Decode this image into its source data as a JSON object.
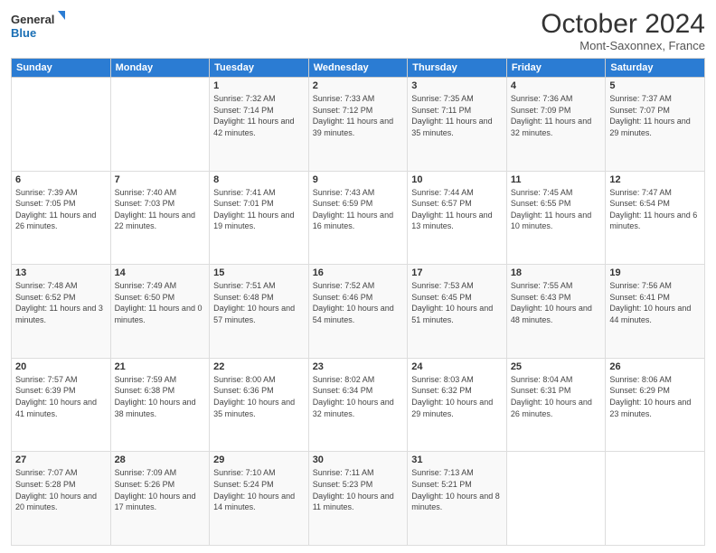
{
  "header": {
    "logo_line1": "General",
    "logo_line2": "Blue",
    "month_title": "October 2024",
    "location": "Mont-Saxonnex, France"
  },
  "weekdays": [
    "Sunday",
    "Monday",
    "Tuesday",
    "Wednesday",
    "Thursday",
    "Friday",
    "Saturday"
  ],
  "weeks": [
    [
      {
        "day": "",
        "sunrise": "",
        "sunset": "",
        "daylight": ""
      },
      {
        "day": "",
        "sunrise": "",
        "sunset": "",
        "daylight": ""
      },
      {
        "day": "1",
        "sunrise": "Sunrise: 7:32 AM",
        "sunset": "Sunset: 7:14 PM",
        "daylight": "Daylight: 11 hours and 42 minutes."
      },
      {
        "day": "2",
        "sunrise": "Sunrise: 7:33 AM",
        "sunset": "Sunset: 7:12 PM",
        "daylight": "Daylight: 11 hours and 39 minutes."
      },
      {
        "day": "3",
        "sunrise": "Sunrise: 7:35 AM",
        "sunset": "Sunset: 7:11 PM",
        "daylight": "Daylight: 11 hours and 35 minutes."
      },
      {
        "day": "4",
        "sunrise": "Sunrise: 7:36 AM",
        "sunset": "Sunset: 7:09 PM",
        "daylight": "Daylight: 11 hours and 32 minutes."
      },
      {
        "day": "5",
        "sunrise": "Sunrise: 7:37 AM",
        "sunset": "Sunset: 7:07 PM",
        "daylight": "Daylight: 11 hours and 29 minutes."
      }
    ],
    [
      {
        "day": "6",
        "sunrise": "Sunrise: 7:39 AM",
        "sunset": "Sunset: 7:05 PM",
        "daylight": "Daylight: 11 hours and 26 minutes."
      },
      {
        "day": "7",
        "sunrise": "Sunrise: 7:40 AM",
        "sunset": "Sunset: 7:03 PM",
        "daylight": "Daylight: 11 hours and 22 minutes."
      },
      {
        "day": "8",
        "sunrise": "Sunrise: 7:41 AM",
        "sunset": "Sunset: 7:01 PM",
        "daylight": "Daylight: 11 hours and 19 minutes."
      },
      {
        "day": "9",
        "sunrise": "Sunrise: 7:43 AM",
        "sunset": "Sunset: 6:59 PM",
        "daylight": "Daylight: 11 hours and 16 minutes."
      },
      {
        "day": "10",
        "sunrise": "Sunrise: 7:44 AM",
        "sunset": "Sunset: 6:57 PM",
        "daylight": "Daylight: 11 hours and 13 minutes."
      },
      {
        "day": "11",
        "sunrise": "Sunrise: 7:45 AM",
        "sunset": "Sunset: 6:55 PM",
        "daylight": "Daylight: 11 hours and 10 minutes."
      },
      {
        "day": "12",
        "sunrise": "Sunrise: 7:47 AM",
        "sunset": "Sunset: 6:54 PM",
        "daylight": "Daylight: 11 hours and 6 minutes."
      }
    ],
    [
      {
        "day": "13",
        "sunrise": "Sunrise: 7:48 AM",
        "sunset": "Sunset: 6:52 PM",
        "daylight": "Daylight: 11 hours and 3 minutes."
      },
      {
        "day": "14",
        "sunrise": "Sunrise: 7:49 AM",
        "sunset": "Sunset: 6:50 PM",
        "daylight": "Daylight: 11 hours and 0 minutes."
      },
      {
        "day": "15",
        "sunrise": "Sunrise: 7:51 AM",
        "sunset": "Sunset: 6:48 PM",
        "daylight": "Daylight: 10 hours and 57 minutes."
      },
      {
        "day": "16",
        "sunrise": "Sunrise: 7:52 AM",
        "sunset": "Sunset: 6:46 PM",
        "daylight": "Daylight: 10 hours and 54 minutes."
      },
      {
        "day": "17",
        "sunrise": "Sunrise: 7:53 AM",
        "sunset": "Sunset: 6:45 PM",
        "daylight": "Daylight: 10 hours and 51 minutes."
      },
      {
        "day": "18",
        "sunrise": "Sunrise: 7:55 AM",
        "sunset": "Sunset: 6:43 PM",
        "daylight": "Daylight: 10 hours and 48 minutes."
      },
      {
        "day": "19",
        "sunrise": "Sunrise: 7:56 AM",
        "sunset": "Sunset: 6:41 PM",
        "daylight": "Daylight: 10 hours and 44 minutes."
      }
    ],
    [
      {
        "day": "20",
        "sunrise": "Sunrise: 7:57 AM",
        "sunset": "Sunset: 6:39 PM",
        "daylight": "Daylight: 10 hours and 41 minutes."
      },
      {
        "day": "21",
        "sunrise": "Sunrise: 7:59 AM",
        "sunset": "Sunset: 6:38 PM",
        "daylight": "Daylight: 10 hours and 38 minutes."
      },
      {
        "day": "22",
        "sunrise": "Sunrise: 8:00 AM",
        "sunset": "Sunset: 6:36 PM",
        "daylight": "Daylight: 10 hours and 35 minutes."
      },
      {
        "day": "23",
        "sunrise": "Sunrise: 8:02 AM",
        "sunset": "Sunset: 6:34 PM",
        "daylight": "Daylight: 10 hours and 32 minutes."
      },
      {
        "day": "24",
        "sunrise": "Sunrise: 8:03 AM",
        "sunset": "Sunset: 6:32 PM",
        "daylight": "Daylight: 10 hours and 29 minutes."
      },
      {
        "day": "25",
        "sunrise": "Sunrise: 8:04 AM",
        "sunset": "Sunset: 6:31 PM",
        "daylight": "Daylight: 10 hours and 26 minutes."
      },
      {
        "day": "26",
        "sunrise": "Sunrise: 8:06 AM",
        "sunset": "Sunset: 6:29 PM",
        "daylight": "Daylight: 10 hours and 23 minutes."
      }
    ],
    [
      {
        "day": "27",
        "sunrise": "Sunrise: 7:07 AM",
        "sunset": "Sunset: 5:28 PM",
        "daylight": "Daylight: 10 hours and 20 minutes."
      },
      {
        "day": "28",
        "sunrise": "Sunrise: 7:09 AM",
        "sunset": "Sunset: 5:26 PM",
        "daylight": "Daylight: 10 hours and 17 minutes."
      },
      {
        "day": "29",
        "sunrise": "Sunrise: 7:10 AM",
        "sunset": "Sunset: 5:24 PM",
        "daylight": "Daylight: 10 hours and 14 minutes."
      },
      {
        "day": "30",
        "sunrise": "Sunrise: 7:11 AM",
        "sunset": "Sunset: 5:23 PM",
        "daylight": "Daylight: 10 hours and 11 minutes."
      },
      {
        "day": "31",
        "sunrise": "Sunrise: 7:13 AM",
        "sunset": "Sunset: 5:21 PM",
        "daylight": "Daylight: 10 hours and 8 minutes."
      },
      {
        "day": "",
        "sunrise": "",
        "sunset": "",
        "daylight": ""
      },
      {
        "day": "",
        "sunrise": "",
        "sunset": "",
        "daylight": ""
      }
    ]
  ]
}
